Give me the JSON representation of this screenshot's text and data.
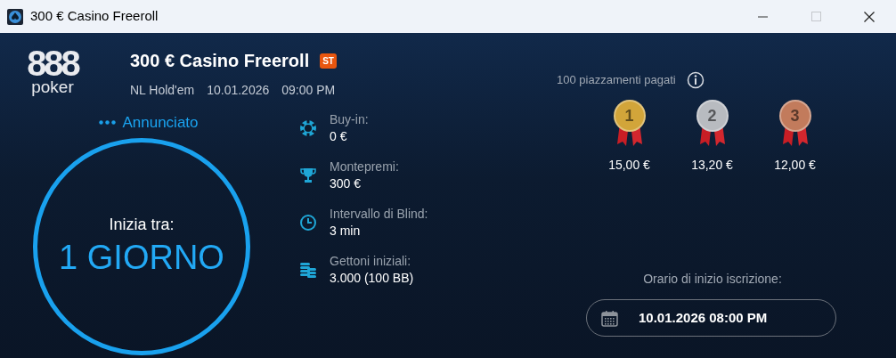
{
  "window": {
    "title": "300 € Casino Freeroll",
    "maximize_disabled": true
  },
  "logo": {
    "digits": "888",
    "word": "poker"
  },
  "tournament": {
    "title": "300 € Casino Freeroll",
    "badge": "ST",
    "game": "NL Hold'em",
    "date": "10.01.2026",
    "time": "09:00 PM"
  },
  "status": {
    "label": "Annunciato",
    "caption": "Inizia tra:",
    "countdown": "1 GIORNO"
  },
  "details": [
    {
      "kind": "chip",
      "label": "Buy-in:",
      "value": "0 €"
    },
    {
      "kind": "trophy",
      "label": "Montepremi:",
      "value": "300 €"
    },
    {
      "kind": "clock",
      "label": "Intervallo di Blind:",
      "value": "3 min"
    },
    {
      "kind": "stack",
      "label": "Gettoni iniziali:",
      "value": "3.000 (100 BB)"
    }
  ],
  "prizes": {
    "header": "100 piazzamenti pagati",
    "places": [
      {
        "place": "1",
        "amount": "15,00 €",
        "color": "#d2a53a"
      },
      {
        "place": "2",
        "amount": "13,20 €",
        "color": "#b8bbc0"
      },
      {
        "place": "3",
        "amount": "12,00 €",
        "color": "#c27b5c"
      }
    ]
  },
  "registration": {
    "label": "Orario di inizio iscrizione:",
    "value": "10.01.2026 08:00 PM"
  }
}
